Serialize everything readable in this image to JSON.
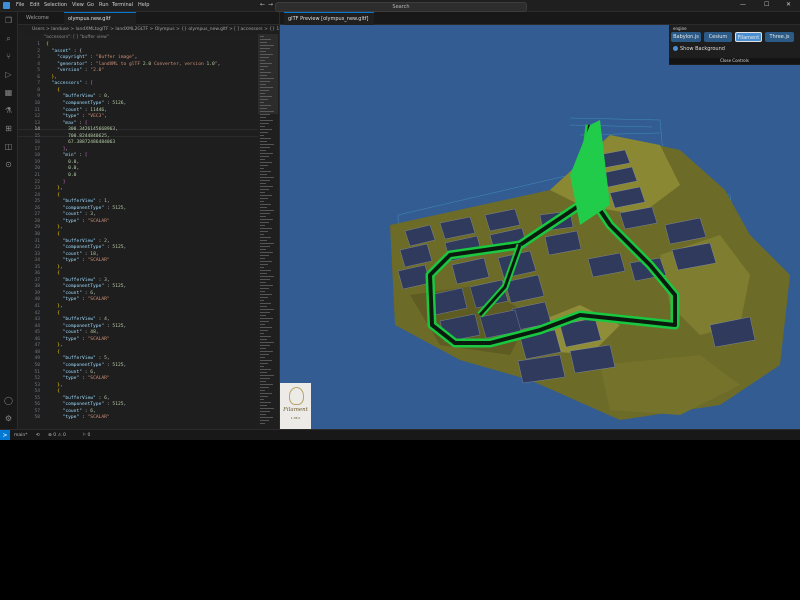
{
  "titlebar": {
    "menus": [
      "File",
      "Edit",
      "Selection",
      "View",
      "Go",
      "Run",
      "Terminal",
      "Help"
    ],
    "search": "Search",
    "nav_back": "←",
    "nav_forward": "→",
    "win_min": "—",
    "win_max": "☐",
    "win_close": "✕"
  },
  "activity": {
    "icons": [
      "explorer-icon",
      "search-icon",
      "source-control-icon",
      "run-debug-icon",
      "extensions-icon",
      "testing-icon",
      "remote-icon",
      "docker-icon",
      "tree-icon"
    ],
    "bottom_icons": [
      "account-icon",
      "settings-gear-icon"
    ]
  },
  "editor": {
    "tabs": [
      {
        "label": "Welcome",
        "active": false
      },
      {
        "label": "olympus.new.gltf",
        "active": true
      }
    ],
    "breadcrumb": "Users > landuse > landXMLtoglTF > landXML2GLTF > Olympus > {} olympus_new.gltf > [ ] accessors > {} 1 > [ ] max",
    "sticky": "\"accessors\": [ ] \"buffer view\"",
    "current_line": 14,
    "lines": [
      {
        "n": 1,
        "t": "{"
      },
      {
        "n": 2,
        "t": "  \"asset\" : {"
      },
      {
        "n": 3,
        "t": "    \"copyright\" : \"Buffer image\","
      },
      {
        "n": 4,
        "t": "    \"generator\" : \"landXML to glTF 2.0 Converter, version 1.0\","
      },
      {
        "n": 5,
        "t": "    \"version\" : \"2.0\""
      },
      {
        "n": 6,
        "t": "  },"
      },
      {
        "n": 7,
        "t": "  \"accessors\" : ["
      },
      {
        "n": 8,
        "t": "    {"
      },
      {
        "n": 9,
        "t": "      \"bufferView\" : 0,"
      },
      {
        "n": 10,
        "t": "      \"componentType\" : 5126,"
      },
      {
        "n": 11,
        "t": "      \"count\" : 11446,"
      },
      {
        "n": 12,
        "t": "      \"type\" : \"VEC3\","
      },
      {
        "n": 13,
        "t": "      \"max\" : ["
      },
      {
        "n": 14,
        "t": "        300.3426145668963,"
      },
      {
        "n": 15,
        "t": "        700.8244840625,"
      },
      {
        "n": 16,
        "t": "        67.38872486484063"
      },
      {
        "n": 17,
        "t": "      ],"
      },
      {
        "n": 18,
        "t": "      \"min\" : ["
      },
      {
        "n": 19,
        "t": "        0.0,"
      },
      {
        "n": 20,
        "t": "        0.0,"
      },
      {
        "n": 21,
        "t": "        0.0"
      },
      {
        "n": 22,
        "t": "      ]"
      },
      {
        "n": 23,
        "t": "    },"
      },
      {
        "n": 24,
        "t": "    {"
      },
      {
        "n": 25,
        "t": "      \"bufferView\" : 1,"
      },
      {
        "n": 26,
        "t": "      \"componentType\" : 5125,"
      },
      {
        "n": 27,
        "t": "      \"count\" : 3,"
      },
      {
        "n": 28,
        "t": "      \"type\" : \"SCALAR\""
      },
      {
        "n": 29,
        "t": "    },"
      },
      {
        "n": 30,
        "t": "    {"
      },
      {
        "n": 31,
        "t": "      \"bufferView\" : 2,"
      },
      {
        "n": 32,
        "t": "      \"componentType\" : 5125,"
      },
      {
        "n": 33,
        "t": "      \"count\" : 18,"
      },
      {
        "n": 34,
        "t": "      \"type\" : \"SCALAR\""
      },
      {
        "n": 35,
        "t": "    },"
      },
      {
        "n": 36,
        "t": "    {"
      },
      {
        "n": 37,
        "t": "      \"bufferView\" : 3,"
      },
      {
        "n": 38,
        "t": "      \"componentType\" : 5125,"
      },
      {
        "n": 39,
        "t": "      \"count\" : 6,"
      },
      {
        "n": 40,
        "t": "      \"type\" : \"SCALAR\""
      },
      {
        "n": 41,
        "t": "    },"
      },
      {
        "n": 42,
        "t": "    {"
      },
      {
        "n": 43,
        "t": "      \"bufferView\" : 4,"
      },
      {
        "n": 44,
        "t": "      \"componentType\" : 5125,"
      },
      {
        "n": 45,
        "t": "      \"count\" : 48,"
      },
      {
        "n": 46,
        "t": "      \"type\" : \"SCALAR\""
      },
      {
        "n": 47,
        "t": "    },"
      },
      {
        "n": 48,
        "t": "    {"
      },
      {
        "n": 49,
        "t": "      \"bufferView\" : 5,"
      },
      {
        "n": 50,
        "t": "      \"componentType\" : 5125,"
      },
      {
        "n": 51,
        "t": "      \"count\" : 6,"
      },
      {
        "n": 52,
        "t": "      \"type\" : \"SCALAR\""
      },
      {
        "n": 53,
        "t": "    },"
      },
      {
        "n": 54,
        "t": "    {"
      },
      {
        "n": 55,
        "t": "      \"bufferView\" : 6,"
      },
      {
        "n": 56,
        "t": "      \"componentType\" : 5125,"
      },
      {
        "n": 57,
        "t": "      \"count\" : 6,"
      },
      {
        "n": 58,
        "t": "      \"type\" : \"SCALAR\""
      }
    ]
  },
  "preview": {
    "tab_label": "glTF Preview [olympus_new.gltf]",
    "engine_title": "engine",
    "engines": [
      {
        "label": "Babylon.js",
        "selected": false
      },
      {
        "label": "Cesium",
        "selected": false
      },
      {
        "label": "Filament",
        "selected": true
      },
      {
        "label": "Three.js",
        "selected": false
      }
    ],
    "show_background": "Show Background",
    "close_controls": "Close Controls",
    "filament_logo_text": "Filament",
    "filament_version": "1.38.0",
    "bg_color": "#335c93",
    "terrain_color": "#7b7a2c",
    "road_color": "#19c740",
    "panel_color": "#2e3a5a"
  },
  "statusbar": {
    "branch": "main*",
    "sync": "⟲",
    "problems": "⊗ 0 ⚠ 0",
    "ports": "⚐ 0",
    "remote_icon": "><"
  }
}
